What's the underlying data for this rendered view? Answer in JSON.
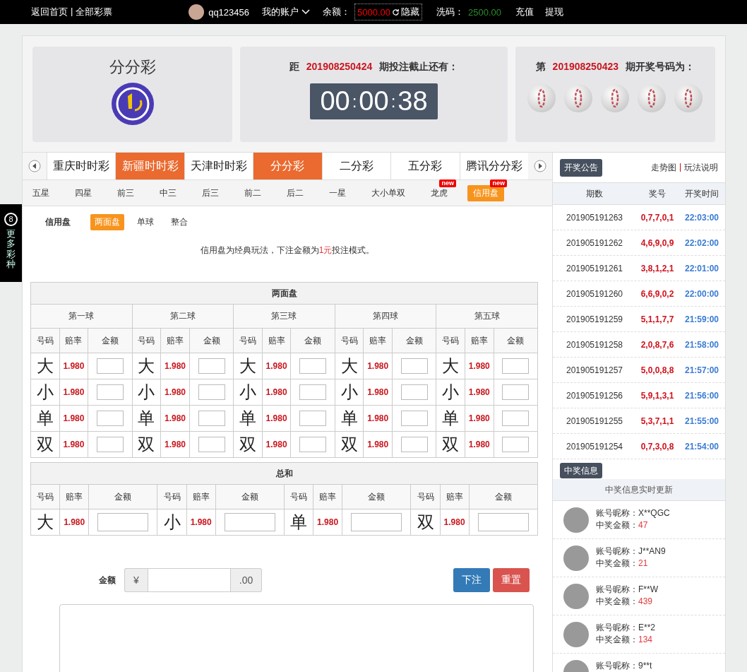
{
  "top_bar": {
    "links": [
      "返回首页",
      "全部彩票"
    ],
    "separator": "|",
    "username": "qq123456",
    "account_menu": "我的账户",
    "balance_label": "余额：",
    "balance": "5000.00",
    "hide": "隐藏",
    "wash_label": "洗码：",
    "wash": "2500.00",
    "actions": [
      "充值",
      "提现"
    ]
  },
  "header": {
    "title": "分分彩",
    "countdown": {
      "prefix": "距",
      "issue": "201908250424",
      "suffix": "期投注截止还有：",
      "time": [
        "00",
        "00",
        "38"
      ],
      "separator": ":"
    },
    "draw": {
      "prefix": "第",
      "issue": "201908250423",
      "suffix": "期开奖号码为："
    }
  },
  "side_tab": {
    "number": "8",
    "label": "更多彩种"
  },
  "game_tabs": [
    {
      "label": "重庆时时彩",
      "selected": false,
      "highlighted": false
    },
    {
      "label": "新疆时时彩",
      "selected": true,
      "highlighted": false
    },
    {
      "label": "天津时时彩",
      "selected": false,
      "highlighted": false
    },
    {
      "label": "分分彩",
      "selected": true,
      "highlighted": false
    },
    {
      "label": "二分彩",
      "selected": false,
      "highlighted": false
    },
    {
      "label": "五分彩",
      "selected": false,
      "highlighted": false
    },
    {
      "label": "腾讯分分彩",
      "selected": false,
      "highlighted": false
    }
  ],
  "play_tabs": [
    {
      "label": "五星",
      "selected": false
    },
    {
      "label": "四星",
      "selected": false
    },
    {
      "label": "前三",
      "selected": false
    },
    {
      "label": "中三",
      "selected": false
    },
    {
      "label": "后三",
      "selected": false
    },
    {
      "label": "前二",
      "selected": false
    },
    {
      "label": "后二",
      "selected": false
    },
    {
      "label": "一星",
      "selected": false
    },
    {
      "label": "大小单双",
      "selected": false
    },
    {
      "label": "龙虎",
      "selected": false,
      "badge": "new"
    },
    {
      "label": "信用盘",
      "selected": true,
      "badge": "new"
    }
  ],
  "sub_tabs": {
    "label": "信用盘",
    "options": [
      {
        "label": "两面盘",
        "selected": true
      },
      {
        "label": "单球",
        "selected": false
      },
      {
        "label": "整合",
        "selected": false
      }
    ]
  },
  "notice": {
    "before": "信用盘为经典玩法，下注金额为",
    "highlight": "1元",
    "after": "投注模式。"
  },
  "two_sides_table": {
    "title": "两面盘",
    "balls": [
      {
        "name": "第一球",
        "columns": [
          "号码",
          "赔率",
          "金额"
        ],
        "items": [
          {
            "code": "大",
            "odds": "1.980"
          },
          {
            "code": "小",
            "odds": "1.980"
          },
          {
            "code": "单",
            "odds": "1.980"
          },
          {
            "code": "双",
            "odds": "1.980"
          }
        ]
      },
      {
        "name": "第二球",
        "columns": [
          "号码",
          "赔率",
          "金额"
        ],
        "items": [
          {
            "code": "大",
            "odds": "1.980"
          },
          {
            "code": "小",
            "odds": "1.980"
          },
          {
            "code": "单",
            "odds": "1.980"
          },
          {
            "code": "双",
            "odds": "1.980"
          }
        ]
      },
      {
        "name": "第三球",
        "columns": [
          "号码",
          "赔率",
          "金额"
        ],
        "items": [
          {
            "code": "大",
            "odds": "1.980"
          },
          {
            "code": "小",
            "odds": "1.980"
          },
          {
            "code": "单",
            "odds": "1.980"
          },
          {
            "code": "双",
            "odds": "1.980"
          }
        ]
      },
      {
        "name": "第四球",
        "columns": [
          "号码",
          "赔率",
          "金额"
        ],
        "items": [
          {
            "code": "大",
            "odds": "1.980"
          },
          {
            "code": "小",
            "odds": "1.980"
          },
          {
            "code": "单",
            "odds": "1.980"
          },
          {
            "code": "双",
            "odds": "1.980"
          }
        ]
      },
      {
        "name": "第五球",
        "columns": [
          "号码",
          "赔率",
          "金额"
        ],
        "items": [
          {
            "code": "大",
            "odds": "1.980"
          },
          {
            "code": "小",
            "odds": "1.980"
          },
          {
            "code": "单",
            "odds": "1.980"
          },
          {
            "code": "双",
            "odds": "1.980"
          }
        ]
      }
    ]
  },
  "sum_table": {
    "title": "总和",
    "groups": [
      {
        "columns": [
          "号码",
          "赔率",
          "金额"
        ],
        "code": "大",
        "odds": "1.980"
      },
      {
        "columns": [
          "号码",
          "赔率",
          "金额"
        ],
        "code": "小",
        "odds": "1.980"
      },
      {
        "columns": [
          "号码",
          "赔率",
          "金额"
        ],
        "code": "单",
        "odds": "1.980"
      },
      {
        "columns": [
          "号码",
          "赔率",
          "金额"
        ],
        "code": "双",
        "odds": "1.980"
      }
    ]
  },
  "bet_form": {
    "label": "金额",
    "prefix": "¥",
    "suffix": ".00",
    "buttons": [
      {
        "label": "下注",
        "kind": "primary"
      },
      {
        "label": "重置",
        "kind": "danger"
      }
    ]
  },
  "results": {
    "title": "开奖公告",
    "links": [
      "走势图",
      "玩法说明"
    ],
    "separator": "|",
    "columns": [
      "期数",
      "奖号",
      "开奖时间"
    ],
    "rows": [
      {
        "issue": "201905191263",
        "numbers": "0,7,7,0,1",
        "time": "22:03:00"
      },
      {
        "issue": "201905191262",
        "numbers": "4,6,9,0,9",
        "time": "22:02:00"
      },
      {
        "issue": "201905191261",
        "numbers": "3,8,1,2,1",
        "time": "22:01:00"
      },
      {
        "issue": "201905191260",
        "numbers": "6,6,9,0,2",
        "time": "22:00:00"
      },
      {
        "issue": "201905191259",
        "numbers": "5,1,1,7,7",
        "time": "21:59:00"
      },
      {
        "issue": "201905191258",
        "numbers": "2,0,8,7,6",
        "time": "21:58:00"
      },
      {
        "issue": "201905191257",
        "numbers": "5,0,0,8,8",
        "time": "21:57:00"
      },
      {
        "issue": "201905191256",
        "numbers": "5,9,1,3,1",
        "time": "21:56:00"
      },
      {
        "issue": "201905191255",
        "numbers": "5,3,7,1,1",
        "time": "21:55:00"
      },
      {
        "issue": "201905191254",
        "numbers": "0,7,3,0,8",
        "time": "21:54:00"
      }
    ]
  },
  "winners": {
    "title": "中奖信息",
    "subtitle": "中奖信息实时更新",
    "items": [
      {
        "name_label": "账号昵称：",
        "nickname": "X**QGC",
        "amount_label": "中奖金额：",
        "amount": "47"
      },
      {
        "name_label": "账号昵称：",
        "nickname": "J**AN9",
        "amount_label": "中奖金额：",
        "amount": "21"
      },
      {
        "name_label": "账号昵称：",
        "nickname": "F**W",
        "amount_label": "中奖金额：",
        "amount": "439"
      },
      {
        "name_label": "账号昵称：",
        "nickname": "E**2",
        "amount_label": "中奖金额：",
        "amount": "134"
      },
      {
        "name_label": "账号昵称：",
        "nickname": "9**t"
      }
    ]
  }
}
